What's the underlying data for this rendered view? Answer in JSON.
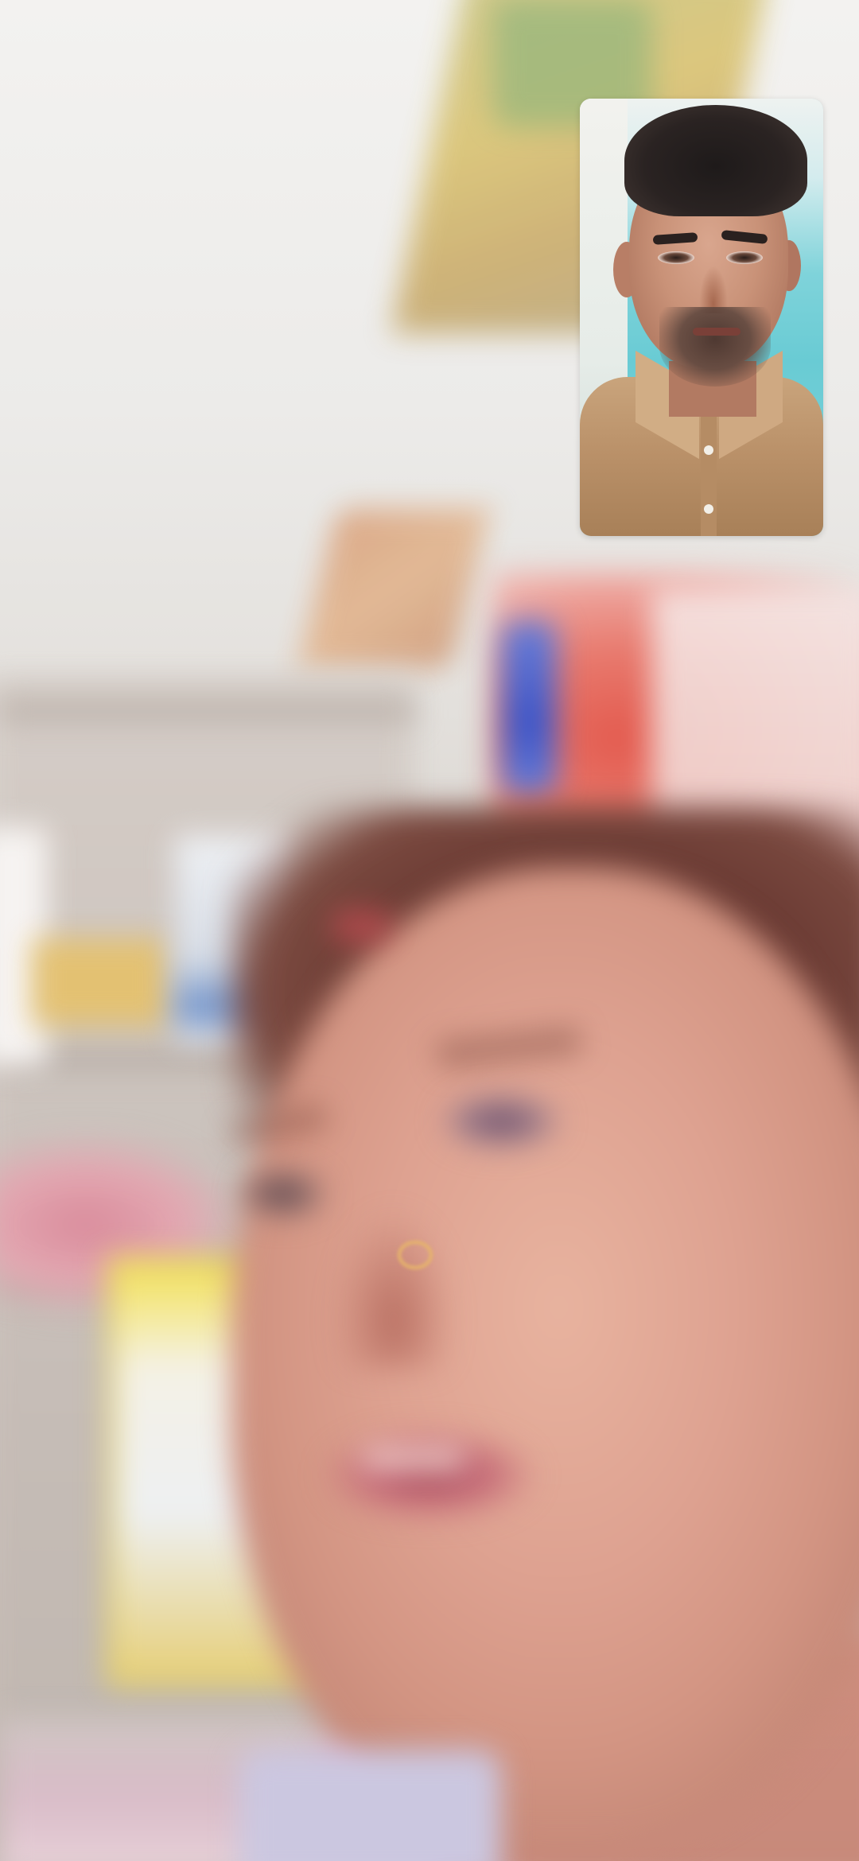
{
  "call": {
    "remote_video_label": "",
    "self_view_label": ""
  },
  "colors": {
    "pip_border": "#ffffff",
    "background": "#d9d4cf"
  },
  "icons": []
}
